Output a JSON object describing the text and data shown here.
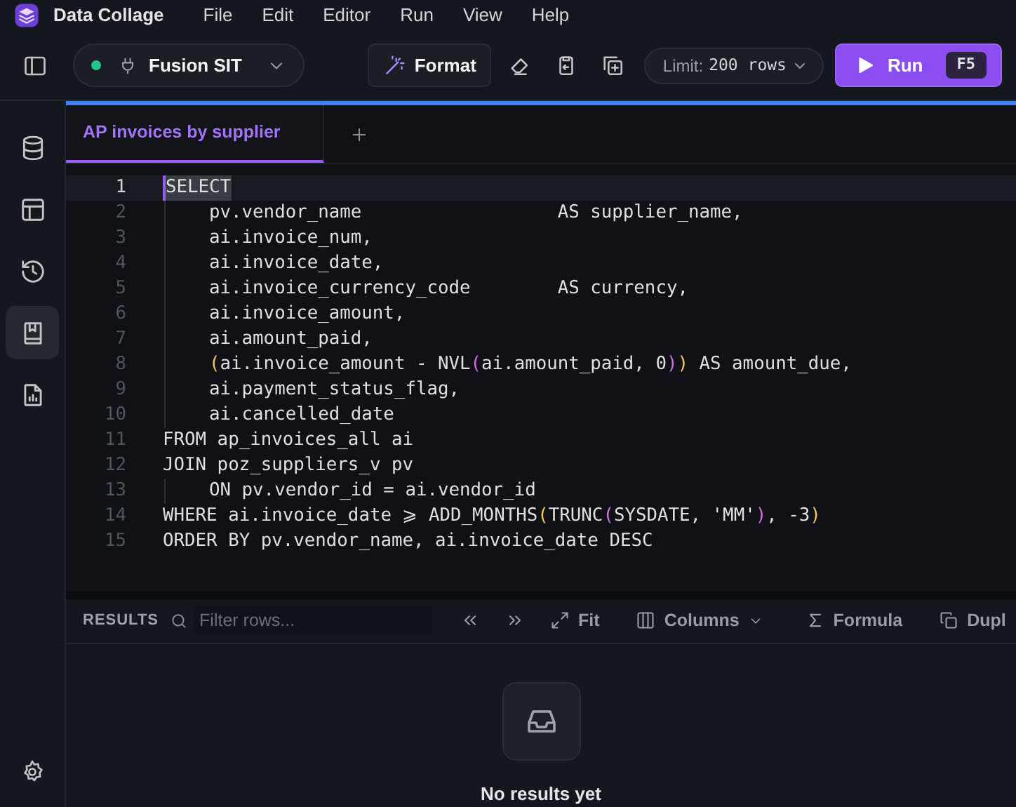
{
  "app": {
    "title": "Data Collage",
    "menu": [
      "File",
      "Edit",
      "Editor",
      "Run",
      "View",
      "Help"
    ]
  },
  "toolbar": {
    "connection": {
      "name": "Fusion SIT",
      "color": "#22c58b"
    },
    "format": "Format",
    "limit_label": "Limit:",
    "limit_value": "200 rows",
    "run": "Run",
    "run_key": "F5"
  },
  "sidebar": {
    "items": [
      {
        "selected": false
      },
      {
        "selected": false
      },
      {
        "selected": false
      },
      {
        "selected": true
      },
      {
        "selected": false
      }
    ]
  },
  "tabs": [
    {
      "label": "AP invoices by supplier",
      "selected": true
    }
  ],
  "editor": {
    "lines": [
      {
        "number": "1",
        "current": true,
        "indent": false,
        "tokens": [
          {
            "kind": "plain",
            "text": "SELECT"
          }
        ]
      },
      {
        "number": "2",
        "current": false,
        "indent": true,
        "tokens": [
          {
            "kind": "plain",
            "text": "pv.vendor_name                  AS supplier_name,"
          }
        ]
      },
      {
        "number": "3",
        "current": false,
        "indent": true,
        "tokens": [
          {
            "kind": "plain",
            "text": "ai.invoice_num,"
          }
        ]
      },
      {
        "number": "4",
        "current": false,
        "indent": true,
        "tokens": [
          {
            "kind": "plain",
            "text": "ai.invoice_date,"
          }
        ]
      },
      {
        "number": "5",
        "current": false,
        "indent": true,
        "tokens": [
          {
            "kind": "plain",
            "text": "ai.invoice_currency_code        AS currency,"
          }
        ]
      },
      {
        "number": "6",
        "current": false,
        "indent": true,
        "tokens": [
          {
            "kind": "plain",
            "text": "ai.invoice_amount,"
          }
        ]
      },
      {
        "number": "7",
        "current": false,
        "indent": true,
        "tokens": [
          {
            "kind": "plain",
            "text": "ai.amount_paid,"
          }
        ]
      },
      {
        "number": "8",
        "current": false,
        "indent": true,
        "tokens": [
          {
            "kind": "paren1",
            "text": "("
          },
          {
            "kind": "plain",
            "text": "ai.invoice_amount - NVL"
          },
          {
            "kind": "paren2",
            "text": "("
          },
          {
            "kind": "plain",
            "text": "ai.amount_paid, 0"
          },
          {
            "kind": "paren2",
            "text": ")"
          },
          {
            "kind": "paren1",
            "text": ")"
          },
          {
            "kind": "plain",
            "text": " AS amount_due,"
          }
        ]
      },
      {
        "number": "9",
        "current": false,
        "indent": true,
        "tokens": [
          {
            "kind": "plain",
            "text": "ai.payment_status_flag,"
          }
        ]
      },
      {
        "number": "10",
        "current": false,
        "indent": true,
        "tokens": [
          {
            "kind": "plain",
            "text": "ai.cancelled_date"
          }
        ]
      },
      {
        "number": "11",
        "current": false,
        "indent": false,
        "tokens": [
          {
            "kind": "plain",
            "text": "FROM ap_invoices_all ai"
          }
        ]
      },
      {
        "number": "12",
        "current": false,
        "indent": false,
        "tokens": [
          {
            "kind": "plain",
            "text": "JOIN poz_suppliers_v pv"
          }
        ]
      },
      {
        "number": "13",
        "current": false,
        "indent": true,
        "tokens": [
          {
            "kind": "plain",
            "text": "ON pv.vendor_id = ai.vendor_id"
          }
        ]
      },
      {
        "number": "14",
        "current": false,
        "indent": false,
        "tokens": [
          {
            "kind": "plain",
            "text": "WHERE ai.invoice_date ⩾ ADD_MONTHS"
          },
          {
            "kind": "paren1",
            "text": "("
          },
          {
            "kind": "plain",
            "text": "TRUNC"
          },
          {
            "kind": "paren2",
            "text": "("
          },
          {
            "kind": "plain",
            "text": "SYSDATE, 'MM'"
          },
          {
            "kind": "paren2",
            "text": ")"
          },
          {
            "kind": "plain",
            "text": ", -3"
          },
          {
            "kind": "paren1",
            "text": ")"
          }
        ]
      },
      {
        "number": "15",
        "current": false,
        "indent": false,
        "tokens": [
          {
            "kind": "plain",
            "text": "ORDER BY pv.vendor_name, ai.invoice_date DESC"
          }
        ]
      }
    ]
  },
  "results": {
    "label": "RESULTS",
    "filter_placeholder": "Filter rows...",
    "actions": [
      {
        "dropdown": false
      },
      {
        "dropdown": false
      },
      {
        "label": "Fit",
        "dropdown": false
      },
      {
        "label": "Columns",
        "dropdown": true
      },
      {
        "label": "Formula",
        "dropdown": false
      },
      {
        "label": "Dupl",
        "dropdown": false
      }
    ],
    "empty": "No results yet"
  }
}
